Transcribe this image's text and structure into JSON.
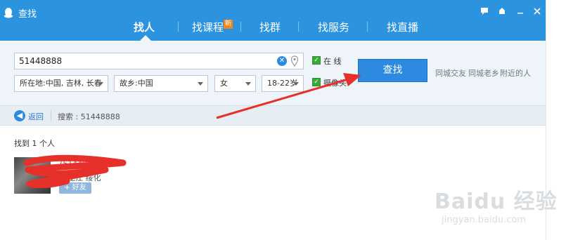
{
  "window": {
    "title": "查找",
    "controls": [
      "feedback-icon",
      "skin-icon",
      "minimize-icon",
      "close-icon"
    ]
  },
  "tabs": [
    {
      "label": "找人",
      "active": true
    },
    {
      "label": "找课程",
      "badge": "新"
    },
    {
      "label": "找群"
    },
    {
      "label": "找服务"
    },
    {
      "label": "找直播"
    }
  ],
  "search": {
    "query": "51448888",
    "placeholder": ""
  },
  "filters": {
    "location": "所在地:中国, 吉林, 长春",
    "hometown": "故乡:中国",
    "gender": "女",
    "age": "18-22岁"
  },
  "options": {
    "online_label": "在 线",
    "online_checked": true,
    "camera_label": "摄像头",
    "camera_checked": true
  },
  "find_button": "查找",
  "quick_links": [
    "同城交友",
    "同城老乡",
    "附近的人"
  ],
  "breadcrumb": {
    "back_label": "返回",
    "search_text": "搜索 : 51448888"
  },
  "results": {
    "count_text": "找到 1 个人",
    "items": [
      {
        "name": "(51448888)",
        "location": "黑龙江 绥化",
        "add_label": "+ 好友"
      }
    ]
  },
  "watermark": {
    "main": "Baidu 经验",
    "sub": "jingyan.baidu.com"
  },
  "colors": {
    "topbar": "#2c93df",
    "panel": "#eef4fa",
    "button": "#2c8ae0",
    "annotation": "#e8302b"
  }
}
